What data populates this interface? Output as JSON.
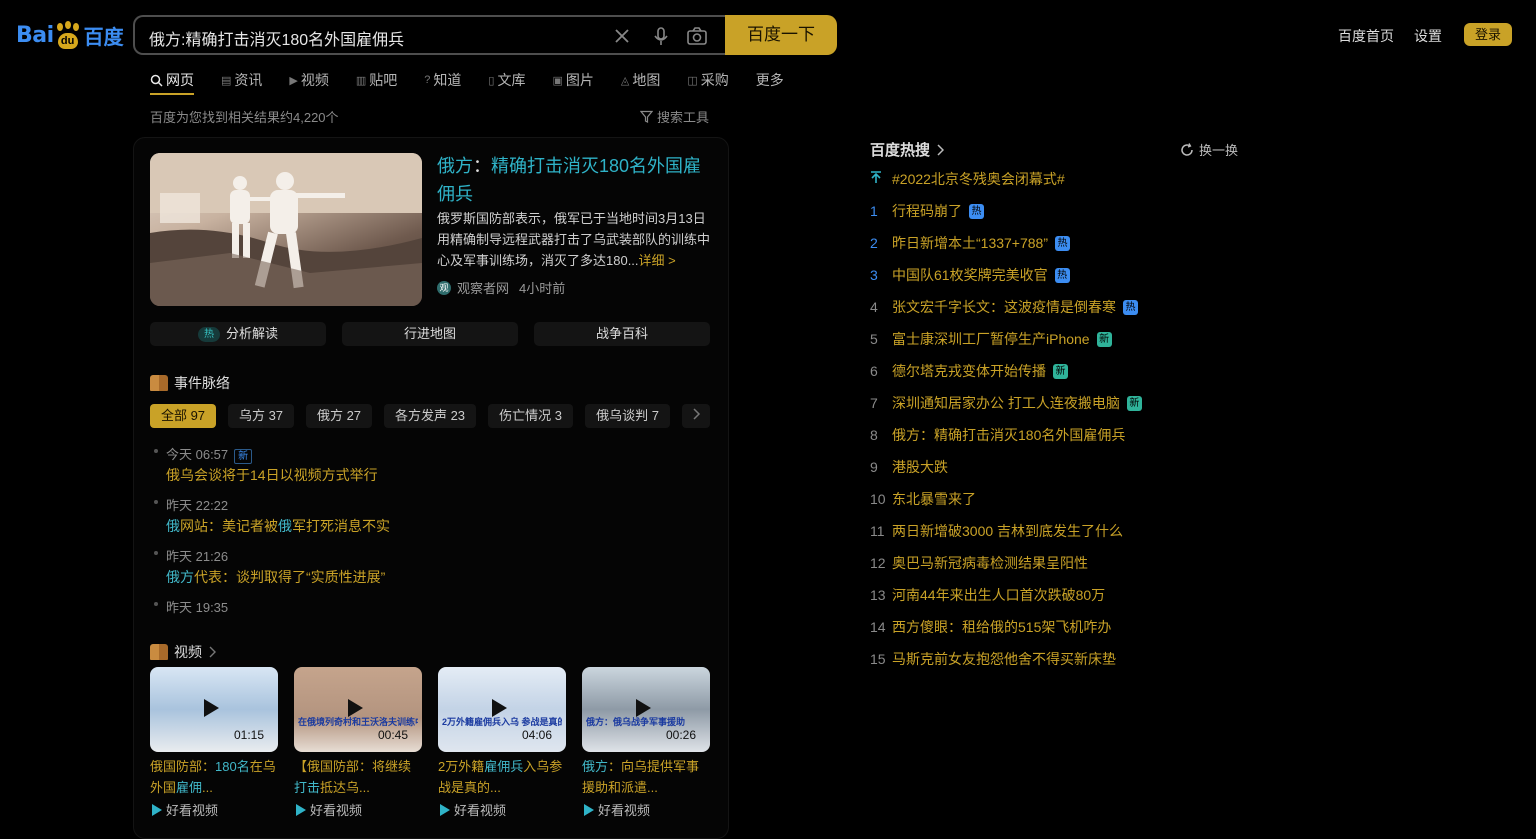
{
  "header": {
    "logo_bai": "Bai",
    "logo_du": "du",
    "logo_cn": "百度",
    "query": "俄方:精确打击消灭180名外国雇佣兵",
    "search_button": "百度一下",
    "links": [
      "百度首页",
      "设置"
    ],
    "login": "登录"
  },
  "tabs": [
    {
      "label": "网页",
      "icon": "search-icon",
      "active": true
    },
    {
      "label": "资讯",
      "icon": "news-icon"
    },
    {
      "label": "视频",
      "icon": "video-icon"
    },
    {
      "label": "贴吧",
      "icon": "tieba-icon"
    },
    {
      "label": "知道",
      "icon": "question-icon"
    },
    {
      "label": "文库",
      "icon": "doc-icon"
    },
    {
      "label": "图片",
      "icon": "image-icon"
    },
    {
      "label": "地图",
      "icon": "map-icon"
    },
    {
      "label": "采购",
      "icon": "shop-icon"
    },
    {
      "label": "更多",
      "icon": ""
    }
  ],
  "result_info": "百度为您找到相关结果约4,220个",
  "search_tools": "搜索工具",
  "result": {
    "title_prefix": "俄方",
    "title_colon": "：",
    "title_main": "精确打击消灭180名外国雇佣兵",
    "desc": "俄罗斯国防部表示，俄军已于当地时间3月13日用精确制导远程武器打击了乌武装部队的训练中心及军事训练场，消灭了多达180...",
    "more": "详细 >",
    "source": "观察者网",
    "source_icon_text": "观",
    "time": "4小时前",
    "pills": [
      {
        "label": "分析解读",
        "badge": "热"
      },
      {
        "label": "行进地图"
      },
      {
        "label": "战争百科"
      }
    ]
  },
  "events": {
    "heading": "事件脉络",
    "chips": [
      "全部 97",
      "乌方 37",
      "俄方 27",
      "各方发声 23",
      "伤亡情况 3",
      "俄乌谈判 7"
    ],
    "items": [
      {
        "time": "今天 06:57",
        "badge": "新",
        "text_parts": [
          {
            "t": "俄乌会谈将于14日以视频方式举行",
            "hl": false
          }
        ]
      },
      {
        "time": "昨天 22:22",
        "text_parts": [
          {
            "t": "俄",
            "hl": true
          },
          {
            "t": "网站：美记者被",
            "hl": false
          },
          {
            "t": "俄",
            "hl": true
          },
          {
            "t": "军打死消息不实",
            "hl": false
          }
        ]
      },
      {
        "time": "昨天 21:26",
        "text_parts": [
          {
            "t": "俄方",
            "hl": true
          },
          {
            "t": "代表：谈判取得了“实质性进展”",
            "hl": false
          }
        ]
      },
      {
        "time": "昨天 19:35",
        "text_parts": []
      }
    ]
  },
  "videos": {
    "heading": "视频",
    "items": [
      {
        "duration": "01:15",
        "title_parts": [
          {
            "t": "俄国防部：",
            "hl": false
          },
          {
            "t": "180名",
            "hl": true
          },
          {
            "t": "在乌外国",
            "hl": false
          },
          {
            "t": "雇佣",
            "hl": true
          },
          {
            "t": "...",
            "hl": false
          }
        ],
        "source": "好看视频",
        "bg": "linear-gradient(180deg,#d8e6f4 0%,#a9c3dd 50%,#e9ecef 100%)",
        "caption": ""
      },
      {
        "duration": "00:45",
        "title_parts": [
          {
            "t": "【俄国防部：将继续",
            "hl": false
          },
          {
            "t": "打击",
            "hl": true
          },
          {
            "t": "抵达乌...",
            "hl": false
          }
        ],
        "source": "好看视频",
        "bg": "linear-gradient(180deg,#c5a48c 0%,#b3947f 60%,#e7ddd4 100%)",
        "caption": "在俄境列奇村和王沃洛夫训练中心"
      },
      {
        "duration": "04:06",
        "title_parts": [
          {
            "t": "2万外籍",
            "hl": false
          },
          {
            "t": "雇佣兵",
            "hl": true
          },
          {
            "t": "入乌参战是真的...",
            "hl": false
          }
        ],
        "source": "好看视频",
        "bg": "linear-gradient(180deg,#e4ecf5 0%,#c3d3e6 50%,#dfe6ef 100%)",
        "caption": "2万外籍雇佣兵入乌 参战是真的"
      },
      {
        "duration": "00:26",
        "title_parts": [
          {
            "t": "俄方",
            "hl": true
          },
          {
            "t": "：向乌提供军事援助和派遣...",
            "hl": false
          }
        ],
        "source": "好看视频",
        "bg": "linear-gradient(180deg,#cbd6de 0%,#8e9aa6 50%,#dfe3e8 100%)",
        "caption": "俄方：俄乌战争军事援助"
      }
    ]
  },
  "hot": {
    "title": "百度热搜",
    "refresh": "换一换",
    "pinned": "#2022北京冬残奥会闭幕式#",
    "items": [
      {
        "rank": "1",
        "text": "行程码崩了",
        "tag": "热",
        "tagtype": "hot"
      },
      {
        "rank": "2",
        "text": "昨日新增本土“1337+788”",
        "tag": "热",
        "tagtype": "hot"
      },
      {
        "rank": "3",
        "text": "中国队61枚奖牌完美收官",
        "tag": "热",
        "tagtype": "hot"
      },
      {
        "rank": "4",
        "text": "张文宏千字长文：这波疫情是倒春寒",
        "tag": "热",
        "tagtype": "hot"
      },
      {
        "rank": "5",
        "text": "富士康深圳工厂暂停生产iPhone",
        "tag": "新",
        "tagtype": "new"
      },
      {
        "rank": "6",
        "text": "德尔塔克戎变体开始传播",
        "tag": "新",
        "tagtype": "new"
      },
      {
        "rank": "7",
        "text": "深圳通知居家办公 打工人连夜搬电脑",
        "tag": "新",
        "tagtype": "new"
      },
      {
        "rank": "8",
        "text": "俄方：精确打击消灭180名外国雇佣兵",
        "tag": "",
        "tagtype": ""
      },
      {
        "rank": "9",
        "text": "港股大跌",
        "tag": "",
        "tagtype": ""
      },
      {
        "rank": "10",
        "text": "东北暴雪来了",
        "tag": "",
        "tagtype": ""
      },
      {
        "rank": "11",
        "text": "两日新增破3000 吉林到底发生了什么",
        "tag": "",
        "tagtype": ""
      },
      {
        "rank": "12",
        "text": "奥巴马新冠病毒检测结果呈阳性",
        "tag": "",
        "tagtype": ""
      },
      {
        "rank": "13",
        "text": "河南44年来出生人口首次跌破80万",
        "tag": "",
        "tagtype": ""
      },
      {
        "rank": "14",
        "text": "西方傻眼：租给俄的515架飞机咋办",
        "tag": "",
        "tagtype": ""
      },
      {
        "rank": "15",
        "text": "马斯克前女友抱怨他舍不得买新床垫",
        "tag": "",
        "tagtype": ""
      }
    ]
  },
  "colors": {
    "accent": "#c9a227",
    "highlight": "#41b7c8",
    "rank_blue": "#3c8df2"
  }
}
